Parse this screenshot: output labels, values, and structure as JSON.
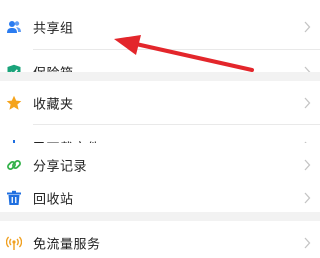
{
  "colors": {
    "accent_blue": "#2b7cf0",
    "vault_green": "#1aa37a",
    "star_orange": "#f5a31a",
    "share_green": "#33b24a",
    "trash_blue": "#1f6fe0",
    "signal_orange": "#f0a020",
    "annotation_red": "#e3262b",
    "gap_gray": "#f2f2f2"
  },
  "groups": [
    {
      "items": [
        {
          "label": "共享组",
          "icon": "users-icon"
        },
        {
          "label": "保险箱",
          "icon": "shield-check-icon"
        }
      ]
    },
    {
      "items": [
        {
          "label": "收藏夹",
          "icon": "star-icon"
        },
        {
          "label": "已下载文件",
          "icon": "download-icon"
        },
        {
          "label": "分享记录",
          "icon": "link-icon"
        },
        {
          "label": "回收站",
          "icon": "trash-icon"
        }
      ]
    },
    {
      "items": [
        {
          "label": "免流量服务",
          "icon": "signal-icon"
        }
      ]
    }
  ],
  "annotation": {
    "type": "arrow",
    "color": "red",
    "points_to": "共享组"
  }
}
